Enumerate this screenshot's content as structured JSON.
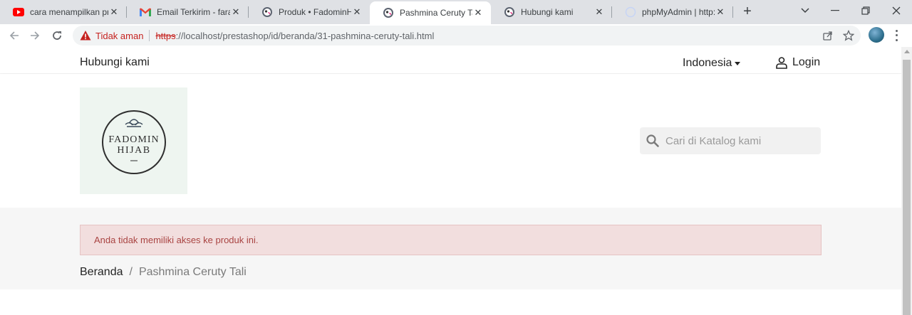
{
  "browser": {
    "tabs": [
      {
        "label": "cara menampilkan pro",
        "icon": "youtube-icon",
        "active": false
      },
      {
        "label": "Email Terkirim - faradi",
        "icon": "gmail-icon",
        "active": false
      },
      {
        "label": "Produk • FadominHija",
        "icon": "prestashop-icon",
        "active": false
      },
      {
        "label": "Pashmina Ceruty Tali",
        "icon": "prestashop-icon",
        "active": true
      },
      {
        "label": "Hubungi kami",
        "icon": "prestashop-icon",
        "active": false
      },
      {
        "label": "phpMyAdmin | http://",
        "icon": "loading-icon",
        "active": false
      }
    ],
    "address": {
      "security_label": "Tidak aman",
      "url_scheme": "https",
      "url_rest": "://localhost/prestashop/id/beranda/31-pashmina-ceruty-tali.html"
    },
    "colors": {
      "warning": "#c5221f",
      "tabbar": "#dfe1e5"
    }
  },
  "page": {
    "header": {
      "contact_label": "Hubungi kami",
      "language_label": "Indonesia",
      "login_label": "Login"
    },
    "logo": {
      "text_line1": "FADOMIN",
      "text_line2": "HIJAB"
    },
    "search": {
      "placeholder": "Cari di Katalog kami"
    },
    "alert": {
      "message": "Anda tidak memiliki akses ke produk ini."
    },
    "breadcrumb": {
      "home": "Beranda",
      "separator": "/",
      "current": "Pashmina Ceruty Tali"
    }
  }
}
